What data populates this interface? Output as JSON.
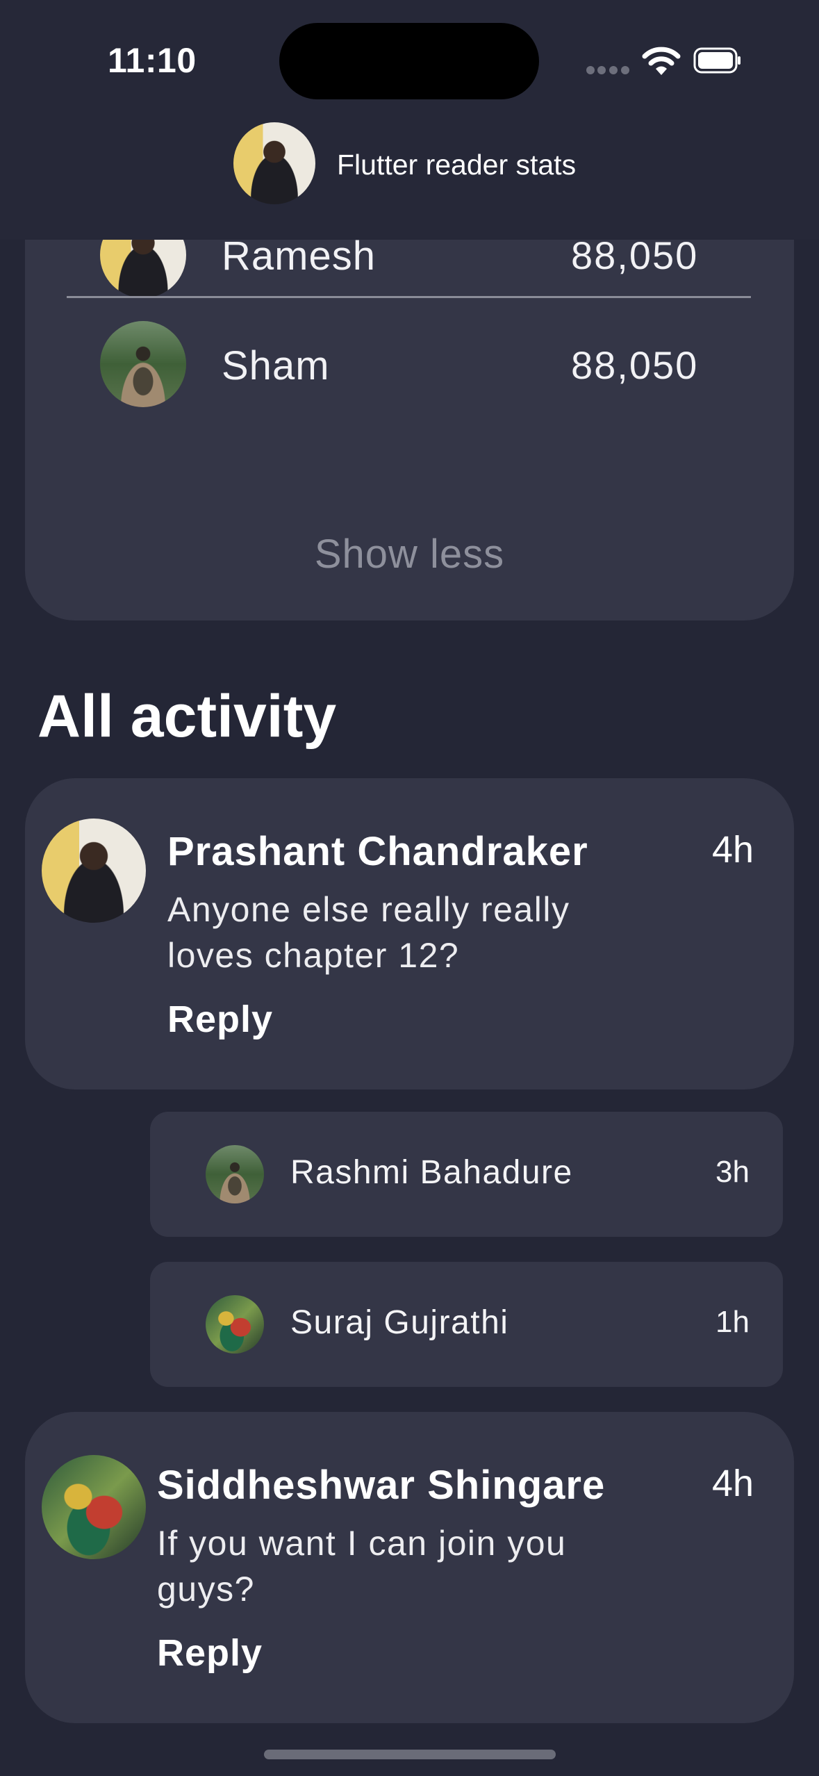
{
  "status_bar": {
    "time": "11:10",
    "icons": [
      "cellular-signal-icon",
      "wifi-icon",
      "battery-icon"
    ]
  },
  "header": {
    "title": "Flutter reader stats",
    "avatar_icon": "profile-avatar"
  },
  "leaderboard": {
    "rows": [
      {
        "name": "Ramesh",
        "value": "88,050"
      },
      {
        "name": "Sham",
        "value": "88,050"
      }
    ],
    "toggle_label": "Show less"
  },
  "activity": {
    "title": "All activity",
    "posts": [
      {
        "author": "Prashant Chandraker",
        "time": "4h",
        "text": "Anyone else really really loves chapter 12?",
        "reply_label": "Reply",
        "replies": [
          {
            "author": "Rashmi Bahadure",
            "time": "3h"
          },
          {
            "author": "Suraj Gujrathi",
            "time": "1h"
          }
        ]
      },
      {
        "author": "Siddheshwar Shingare",
        "time": "4h",
        "text": "If you want I can join you guys?",
        "reply_label": "Reply"
      }
    ]
  },
  "colors": {
    "background": "#242636",
    "card": "#343647",
    "header": "#262838",
    "muted_text": "#8e909c",
    "text": "#ffffff"
  }
}
